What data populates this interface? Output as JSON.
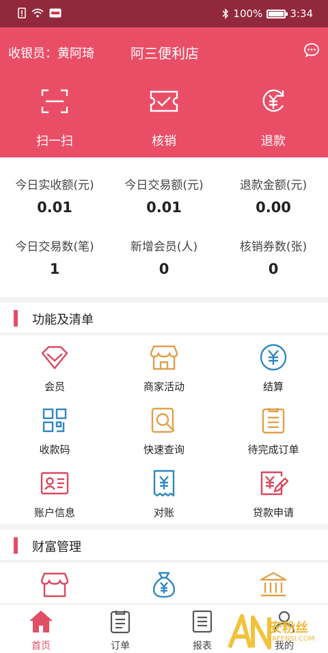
{
  "status_bar": {
    "battery": "100%",
    "time": "3:34",
    "battery_level": 1.0
  },
  "header": {
    "cashier": "收银员：黄阿琦",
    "store_name": "阿三便利店",
    "actions": [
      {
        "label": "扫一扫",
        "icon": "scan-icon"
      },
      {
        "label": "核销",
        "icon": "ticket-icon"
      },
      {
        "label": "退款",
        "icon": "refund-icon"
      }
    ]
  },
  "stats": [
    {
      "label": "今日实收额(元)",
      "value": "0.01"
    },
    {
      "label": "今日交易额(元)",
      "value": "0.01"
    },
    {
      "label": "退款金额(元)",
      "value": "0.00"
    },
    {
      "label": "今日交易数(笔)",
      "value": "1"
    },
    {
      "label": "新增会员(人)",
      "value": "0"
    },
    {
      "label": "核销券数(张)",
      "value": "0"
    }
  ],
  "sections": {
    "functions": {
      "title": "功能及清单",
      "items": [
        {
          "label": "会员",
          "icon": "diamond-icon"
        },
        {
          "label": "商家活动",
          "icon": "shop-icon"
        },
        {
          "label": "结算",
          "icon": "yuan-circle-icon"
        },
        {
          "label": "收款码",
          "icon": "qrcode-icon"
        },
        {
          "label": "快速查询",
          "icon": "search-icon"
        },
        {
          "label": "待完成订单",
          "icon": "order-list-icon"
        },
        {
          "label": "账户信息",
          "icon": "id-card-icon"
        },
        {
          "label": "对账",
          "icon": "receipt-icon"
        },
        {
          "label": "贷款申请",
          "icon": "loan-icon"
        }
      ]
    },
    "wealth": {
      "title": "财富管理",
      "items": [
        {
          "icon": "shop-icon"
        },
        {
          "icon": "money-bag-icon"
        },
        {
          "icon": "bank-icon"
        }
      ]
    }
  },
  "tabbar": [
    {
      "label": "首页",
      "icon": "home-icon",
      "active": true
    },
    {
      "label": "订单",
      "icon": "clipboard-icon"
    },
    {
      "label": "报表",
      "icon": "report-icon"
    },
    {
      "label": "我的",
      "icon": "user-icon"
    }
  ],
  "watermark": {
    "text": "安粉丝",
    "sub": "AFENSI.COM"
  },
  "colors": {
    "status_bar": "#92283c",
    "header": "#ea4e67",
    "accent_red": "#e24f65",
    "icon_orange": "#e0a04b",
    "icon_blue": "#2f86c2"
  }
}
